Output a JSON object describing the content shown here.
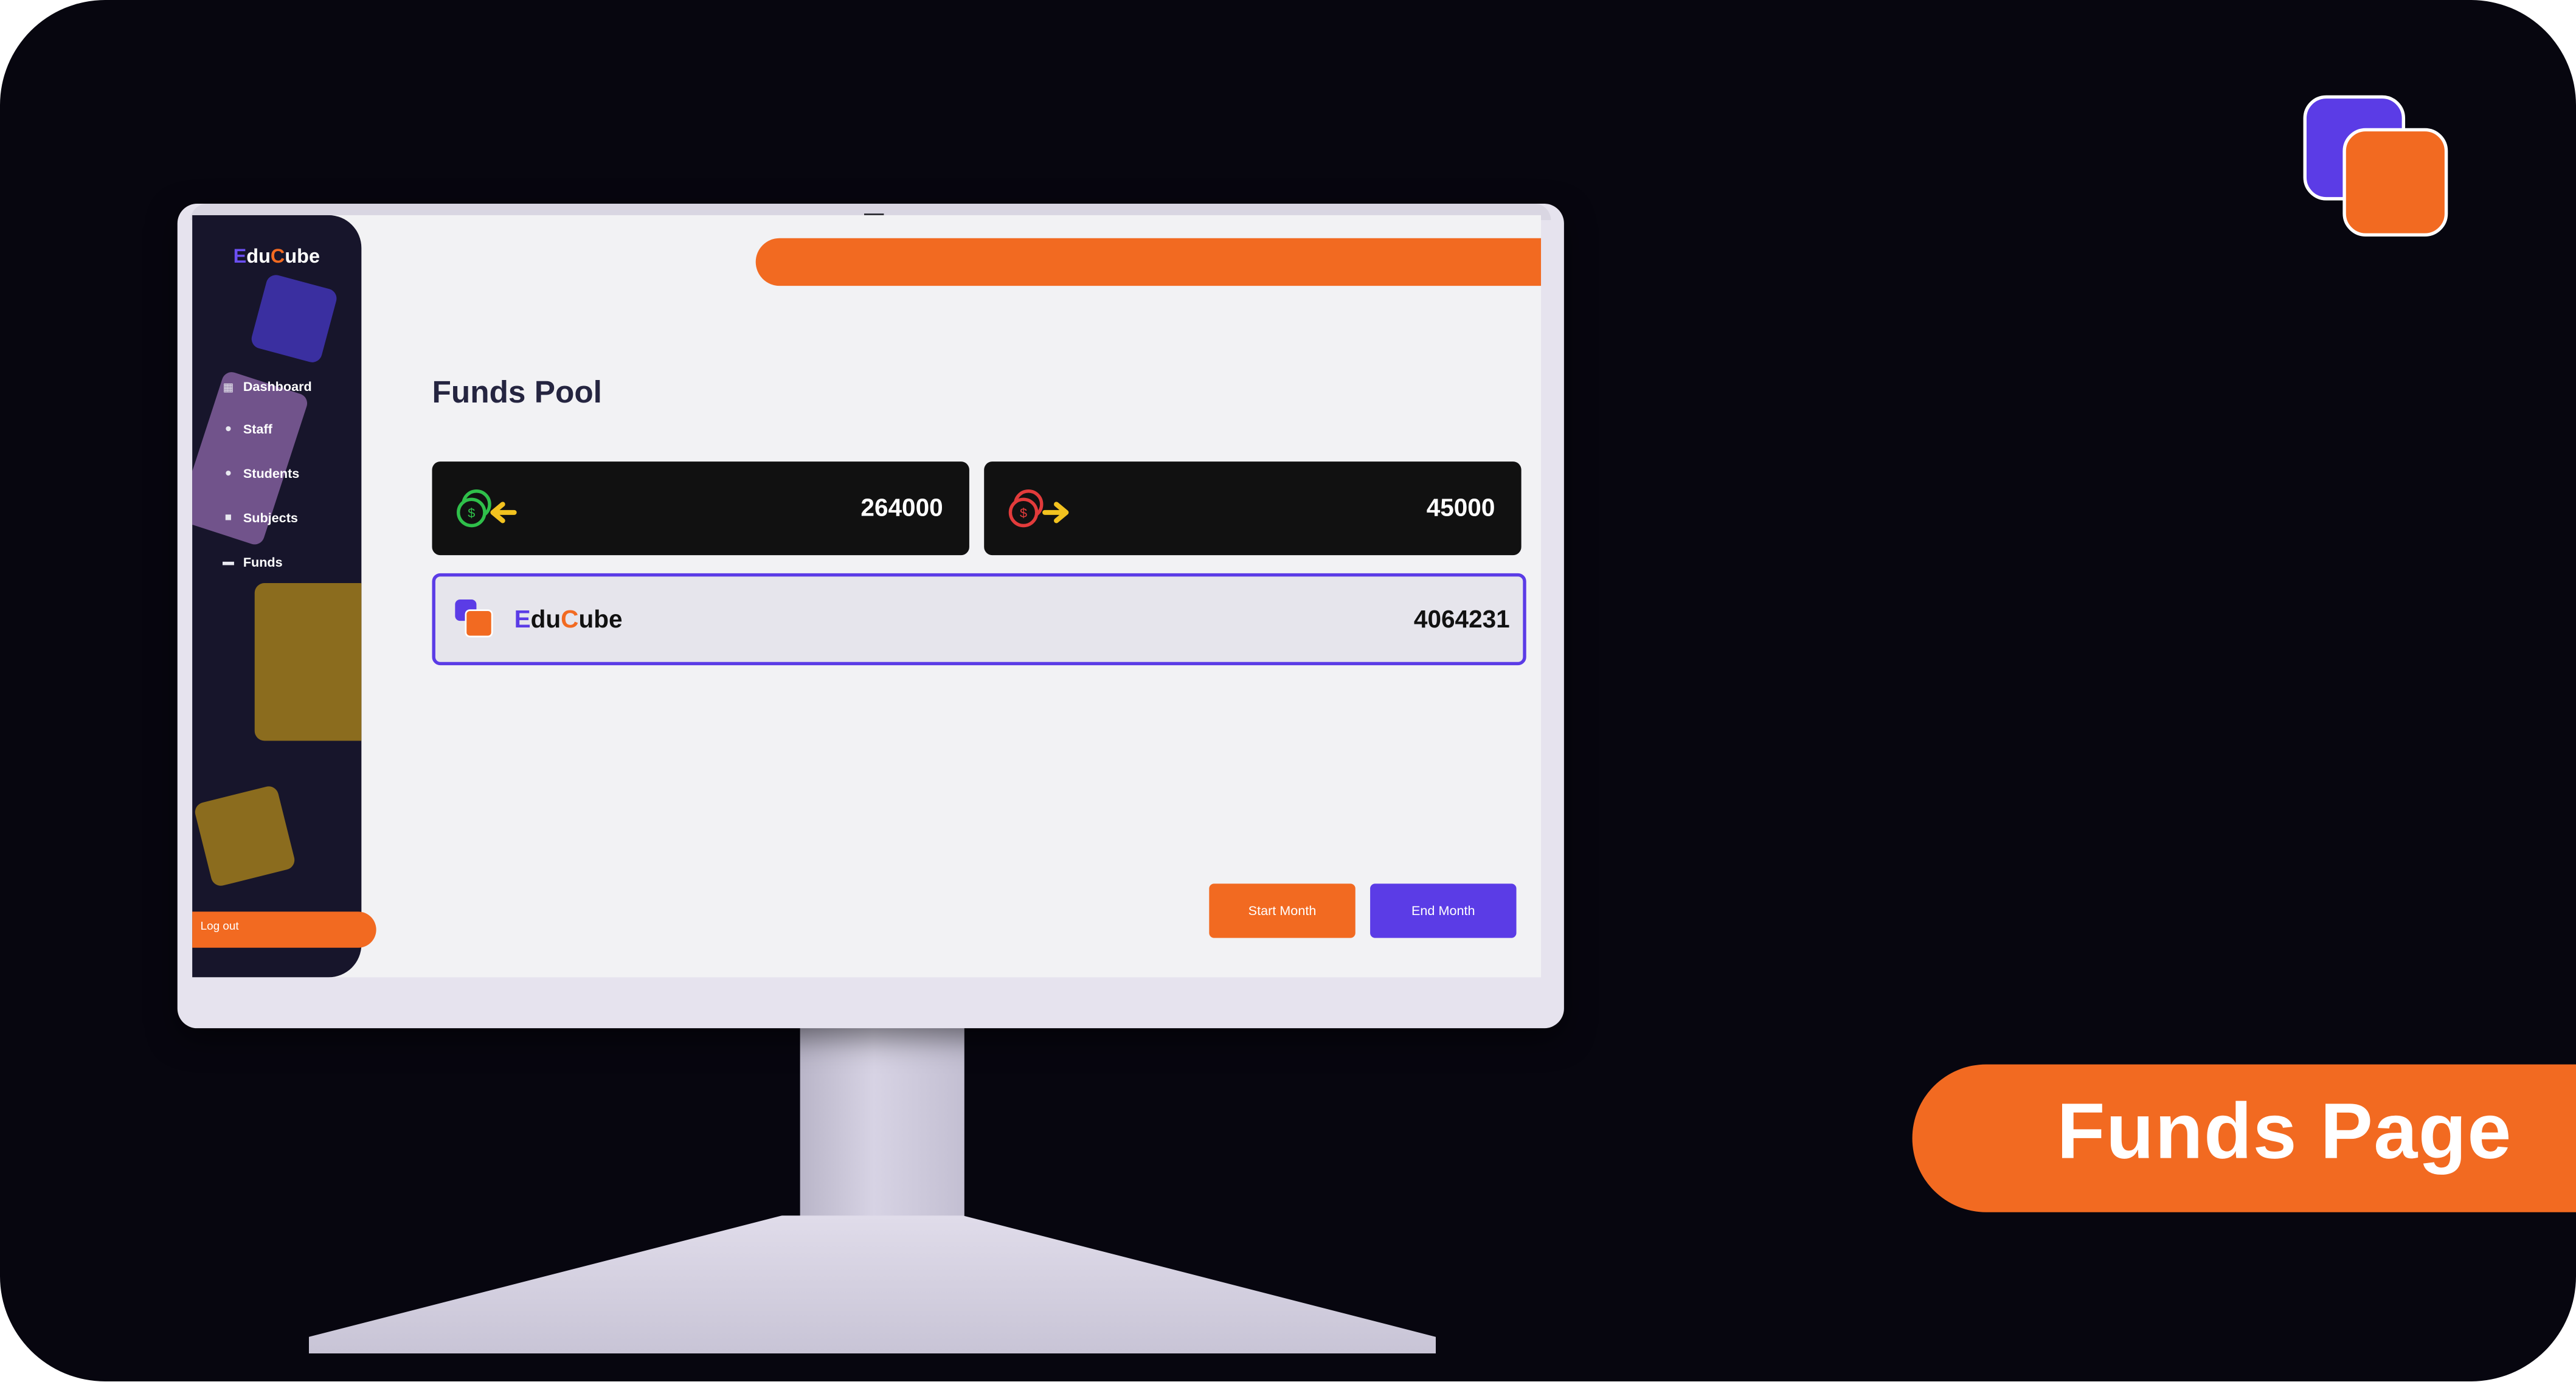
{
  "app": {
    "logo_e": "E",
    "logo_du": "du",
    "logo_c": "C",
    "logo_ube": "ube"
  },
  "sidebar": {
    "items": [
      {
        "label": "Dashboard",
        "icon": "grid-icon"
      },
      {
        "label": "Staff",
        "icon": "user-icon"
      },
      {
        "label": "Students",
        "icon": "students-icon"
      },
      {
        "label": "Subjects",
        "icon": "book-icon"
      },
      {
        "label": "Funds",
        "icon": "money-icon"
      }
    ],
    "logout_label": "Log out"
  },
  "page": {
    "title": "Funds Pool"
  },
  "cards": {
    "incoming": {
      "value": "264000",
      "icon": "coin-incoming-icon"
    },
    "outgoing": {
      "value": "45000",
      "icon": "coin-outgoing-icon"
    }
  },
  "pool": {
    "name_e": "E",
    "name_du": "du",
    "name_c": "C",
    "name_ube": "ube",
    "value": "4064231"
  },
  "actions": {
    "start_label": "Start Month",
    "end_label": "End Month"
  },
  "caption": "Funds Page",
  "colors": {
    "accent_orange": "#f26a21",
    "accent_purple": "#5b3ce6",
    "sidebar_bg": "#17152b",
    "background": "#07060f"
  }
}
